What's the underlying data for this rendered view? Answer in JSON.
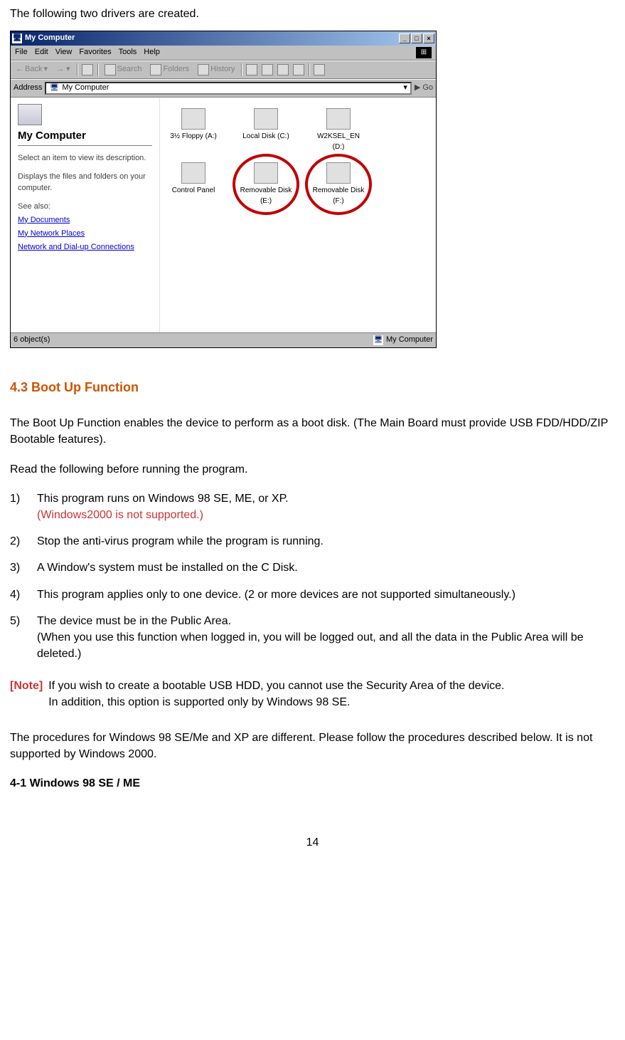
{
  "intro": "The following two drivers are created.",
  "window": {
    "title": "My Computer",
    "menus": [
      "File",
      "Edit",
      "View",
      "Favorites",
      "Tools",
      "Help"
    ],
    "toolbar": {
      "back": "Back",
      "search": "Search",
      "folders": "Folders",
      "history": "History"
    },
    "address_label": "Address",
    "address_value": "My Computer",
    "go": "Go",
    "left": {
      "title": "My Computer",
      "desc1": "Select an item to view its description.",
      "desc2": "Displays the files and folders on your computer.",
      "seealso": "See also:",
      "links": [
        "My Documents",
        "My Network Places",
        "Network and Dial-up Connections"
      ]
    },
    "icons": [
      {
        "label": "3½ Floppy (A:)"
      },
      {
        "label": "Local Disk (C:)"
      },
      {
        "label": "W2KSEL_EN (D:)"
      },
      {
        "label": "Control Panel"
      },
      {
        "label": "Removable Disk (E:)",
        "circled": true
      },
      {
        "label": "Removable Disk (F:)",
        "circled": true
      }
    ],
    "status_left": "6 object(s)",
    "status_right": "My Computer"
  },
  "sec43_heading": "4.3 Boot Up Function",
  "sec43_p1": "The Boot Up Function enables the device to perform as a boot disk. (The Main Board must provide USB FDD/HDD/ZIP Bootable features).",
  "sec43_p2": "Read the following before running the program.",
  "list": [
    {
      "n": "1)",
      "text": "This program runs on Windows 98 SE, ME, or XP.",
      "extra_red": "(Windows2000 is not supported.)"
    },
    {
      "n": "2)",
      "text": "Stop the anti-virus program while the program is running."
    },
    {
      "n": "3)",
      "text": "A Window's system must be installed on the C Disk."
    },
    {
      "n": "4)",
      "text": "This program applies only to one device. (2 or more devices are not supported simultaneously.)"
    },
    {
      "n": "5)",
      "text": "The device must be in the Public Area.",
      "extra": "(When you use this function when logged in, you will be logged out, and all the data in the Public Area will be deleted.)"
    }
  ],
  "note_label": "[Note]",
  "note_line1": "If you wish to create a bootable USB HDD, you cannot use the Security Area of the device.",
  "note_line2": "In addition, this option is supported only by Windows 98 SE.",
  "after_note": "The procedures for Windows 98 SE/Me and XP are different. Please follow the procedures described below. It is not supported by Windows 2000.",
  "sub41": "4-1 Windows 98 SE / ME",
  "pagenum": "14"
}
